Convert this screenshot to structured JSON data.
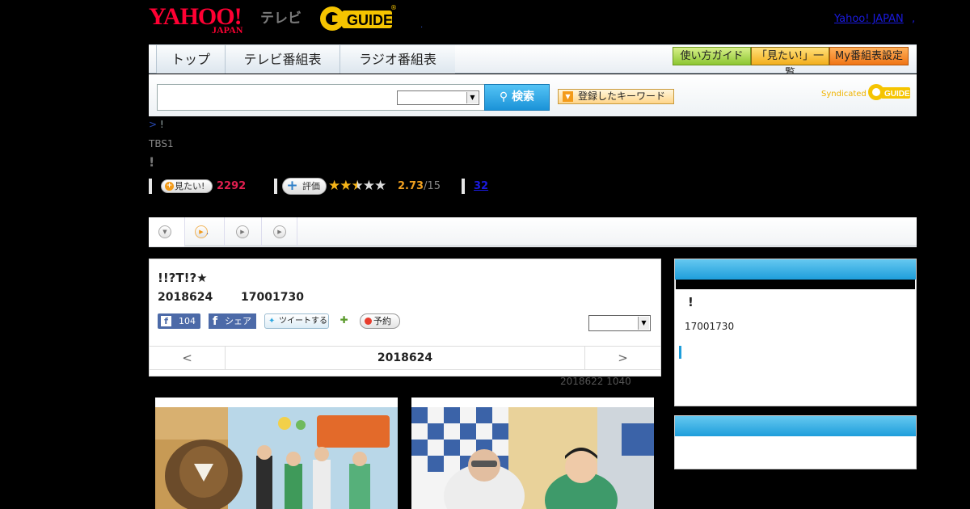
{
  "header": {
    "logo_yahoo": "YAHOO!",
    "logo_japan": "JAPAN",
    "logo_tv": "テレビ",
    "logo_gguide": "G-GUIDE",
    "header_dot": ".",
    "yahoo_link": "Yahoo! JAPAN",
    "yahoo_link_dot": ","
  },
  "nav": {
    "tabs": [
      "トップ",
      "テレビ番組表",
      "ラジオ番組表"
    ],
    "buttons": {
      "guide": "使い方ガイド",
      "mitai_list": "「見たい!」一覧",
      "my_schedule": "My番組表設定"
    }
  },
  "search": {
    "input_value": "",
    "select_value": "",
    "button_label": "検索",
    "keyword_button": "登録したキーワード",
    "syndicated": "Syndicated"
  },
  "program": {
    "breadcrumb_prefix": ">",
    "breadcrumb_rest": " !",
    "channel": "TBS1",
    "title": "!",
    "mitai_label": "見たい!",
    "mitai_count": "2292",
    "hyoka_label": "評価",
    "rating": "2.73",
    "rating_of": "/15",
    "stars_filled": 2.5,
    "stars_total": 5,
    "review_count": "32"
  },
  "tabs": {
    "tab2_dot": "."
  },
  "episode": {
    "title": "!!?T!?★",
    "date": "2018624",
    "time": "17001730",
    "fb_like_count": "104",
    "fb_share": "シェア",
    "tweet": "ツイートする",
    "reserve": "予約",
    "select_value": "",
    "pager_prev": "<",
    "pager_date": "2018624",
    "pager_next": ">",
    "updated": "2018622  1040"
  },
  "sidebar": {
    "box1_title": "!",
    "box1_time": "17001730"
  },
  "colors": {
    "background": "#000000",
    "brand_red": "#ff0033",
    "accent_blue": "#1e9edb",
    "mitai_count": "#e01e4f",
    "star": "#f5b418"
  }
}
